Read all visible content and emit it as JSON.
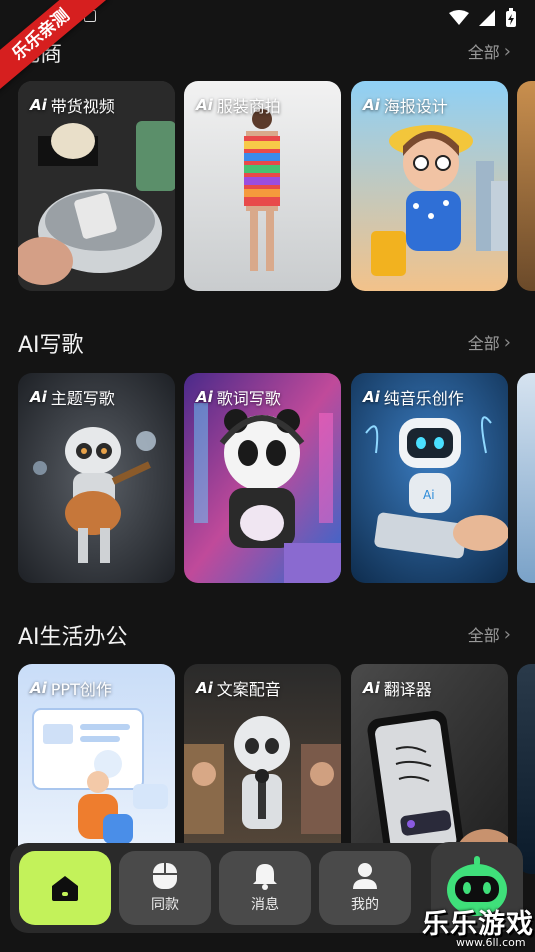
{
  "watermark_badge": "乐乐亲测",
  "watermark_logo": {
    "title": "乐乐游戏",
    "url": "www.6ll.com"
  },
  "sections": [
    {
      "title": "电商",
      "more": "全部",
      "cards": [
        {
          "label": "带货视频"
        },
        {
          "label": "服装商拍"
        },
        {
          "label": "海报设计"
        }
      ]
    },
    {
      "title": "AI写歌",
      "more": "全部",
      "cards": [
        {
          "label": "主题写歌"
        },
        {
          "label": "歌词写歌"
        },
        {
          "label": "纯音乐创作"
        }
      ]
    },
    {
      "title": "AI生活办公",
      "more": "全部",
      "cards": [
        {
          "label": "PPT创作"
        },
        {
          "label": "文案配音"
        },
        {
          "label": "翻译器"
        }
      ]
    }
  ],
  "nav": {
    "home_icon": "home-icon",
    "items": [
      {
        "label": "同款",
        "icon": "mouse-icon"
      },
      {
        "label": "消息",
        "icon": "bell-icon"
      },
      {
        "label": "我的",
        "icon": "person-icon"
      }
    ],
    "robot_icon": "robot-icon"
  },
  "colors": {
    "accent": "#c3f25a",
    "background": "#141414",
    "ribbon": "#d61f1f"
  }
}
